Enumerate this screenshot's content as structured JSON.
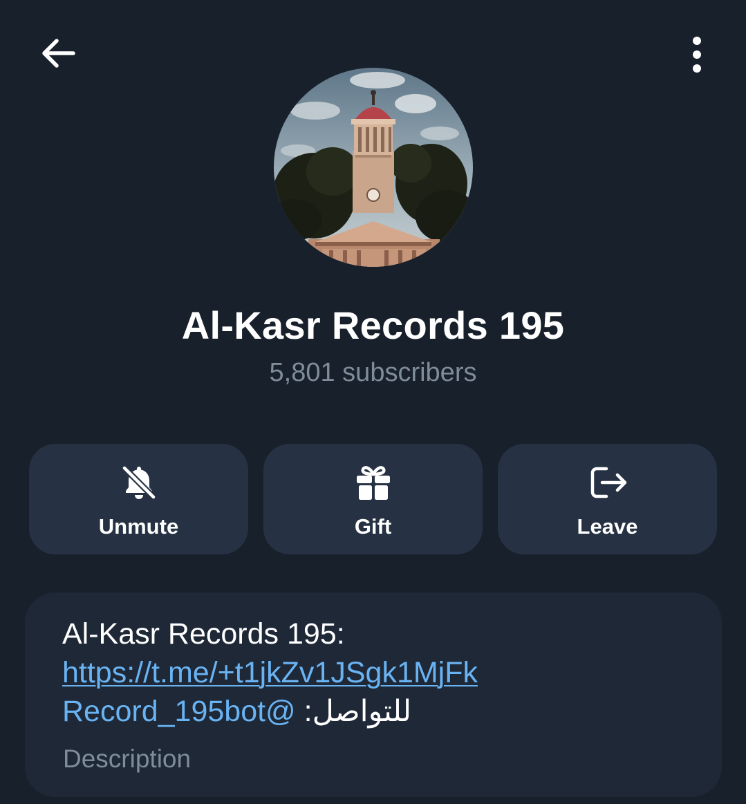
{
  "header": {
    "back_icon": "arrow-left-icon",
    "menu_icon": "more-vertical-icon"
  },
  "channel": {
    "avatar": "clock-tower-photo",
    "title": "Al-Kasr Records 195",
    "subscribers": "5,801 subscribers"
  },
  "actions": [
    {
      "label": "Unmute",
      "icon": "bell-off-icon"
    },
    {
      "label": "Gift",
      "icon": "gift-icon"
    },
    {
      "label": "Leave",
      "icon": "logout-icon"
    }
  ],
  "description": {
    "line1": "Al-Kasr Records 195:",
    "link": "https://t.me/+t1jkZv1JSgk1MjFk",
    "mention": "Record_195bot@",
    "contact_text": " :للتواصل",
    "label": "Description"
  },
  "colors": {
    "background": "#18202c",
    "button_bg": "#263243",
    "card_bg": "#1e2836",
    "link": "#6ab3f3",
    "muted_text": "#7f8c99"
  }
}
